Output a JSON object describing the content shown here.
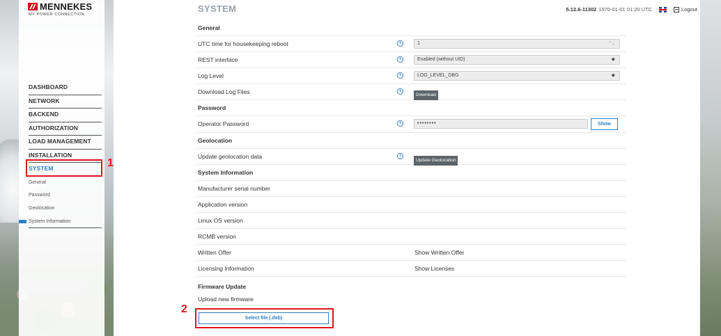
{
  "brand": {
    "name": "MENNEKES",
    "tagline": "MY POWER CONNECTION"
  },
  "nav": {
    "items": [
      "DASHBOARD",
      "NETWORK",
      "BACKEND",
      "AUTHORIZATION",
      "LOAD MANAGEMENT",
      "INSTALLATION",
      "SYSTEM"
    ],
    "active": "SYSTEM",
    "sub_items": [
      "General",
      "Password",
      "Geolocation",
      "System Information"
    ]
  },
  "header": {
    "title": "SYSTEM",
    "version": "5.12.6-11302",
    "datetime": "1970-01-01 01:20 UTC",
    "logout": "Logout"
  },
  "general": {
    "heading": "General",
    "reboot_label": "UTC time for housekeeping reboot",
    "reboot_value": "1",
    "rest_label": "REST interface",
    "rest_value": "Enabled (without UID)",
    "log_label": "Log Level",
    "log_value": "LOG_LEVEL_DBG",
    "download_label": "Download Log Files",
    "download_button": "Download"
  },
  "password": {
    "heading": "Password",
    "operator_label": "Operator Password",
    "operator_value": "••••••••",
    "show_button": "Show"
  },
  "geolocation": {
    "heading": "Geolocation",
    "update_label": "Update geolocation data",
    "update_button": "Update Geolocation"
  },
  "system_info": {
    "heading": "System Information",
    "serial_label": "Manufacturer serial number",
    "app_label": "Application version",
    "linux_label": "Linux OS version",
    "rcmb_label": "RCMB version",
    "offer_label": "Written Offer",
    "offer_link": "Show Written Offer",
    "licensing_label": "Licensing Information",
    "licensing_link": "Show Licenses"
  },
  "firmware": {
    "heading": "Firmware Update",
    "upload_label": "Upload new firmware",
    "select_button": "Select file (.deb)"
  },
  "annotations": {
    "one": "1",
    "two": "2",
    "color": "#e0141e"
  },
  "colors": {
    "accent": "#2b7fc2",
    "brand_red": "#d6001c"
  }
}
